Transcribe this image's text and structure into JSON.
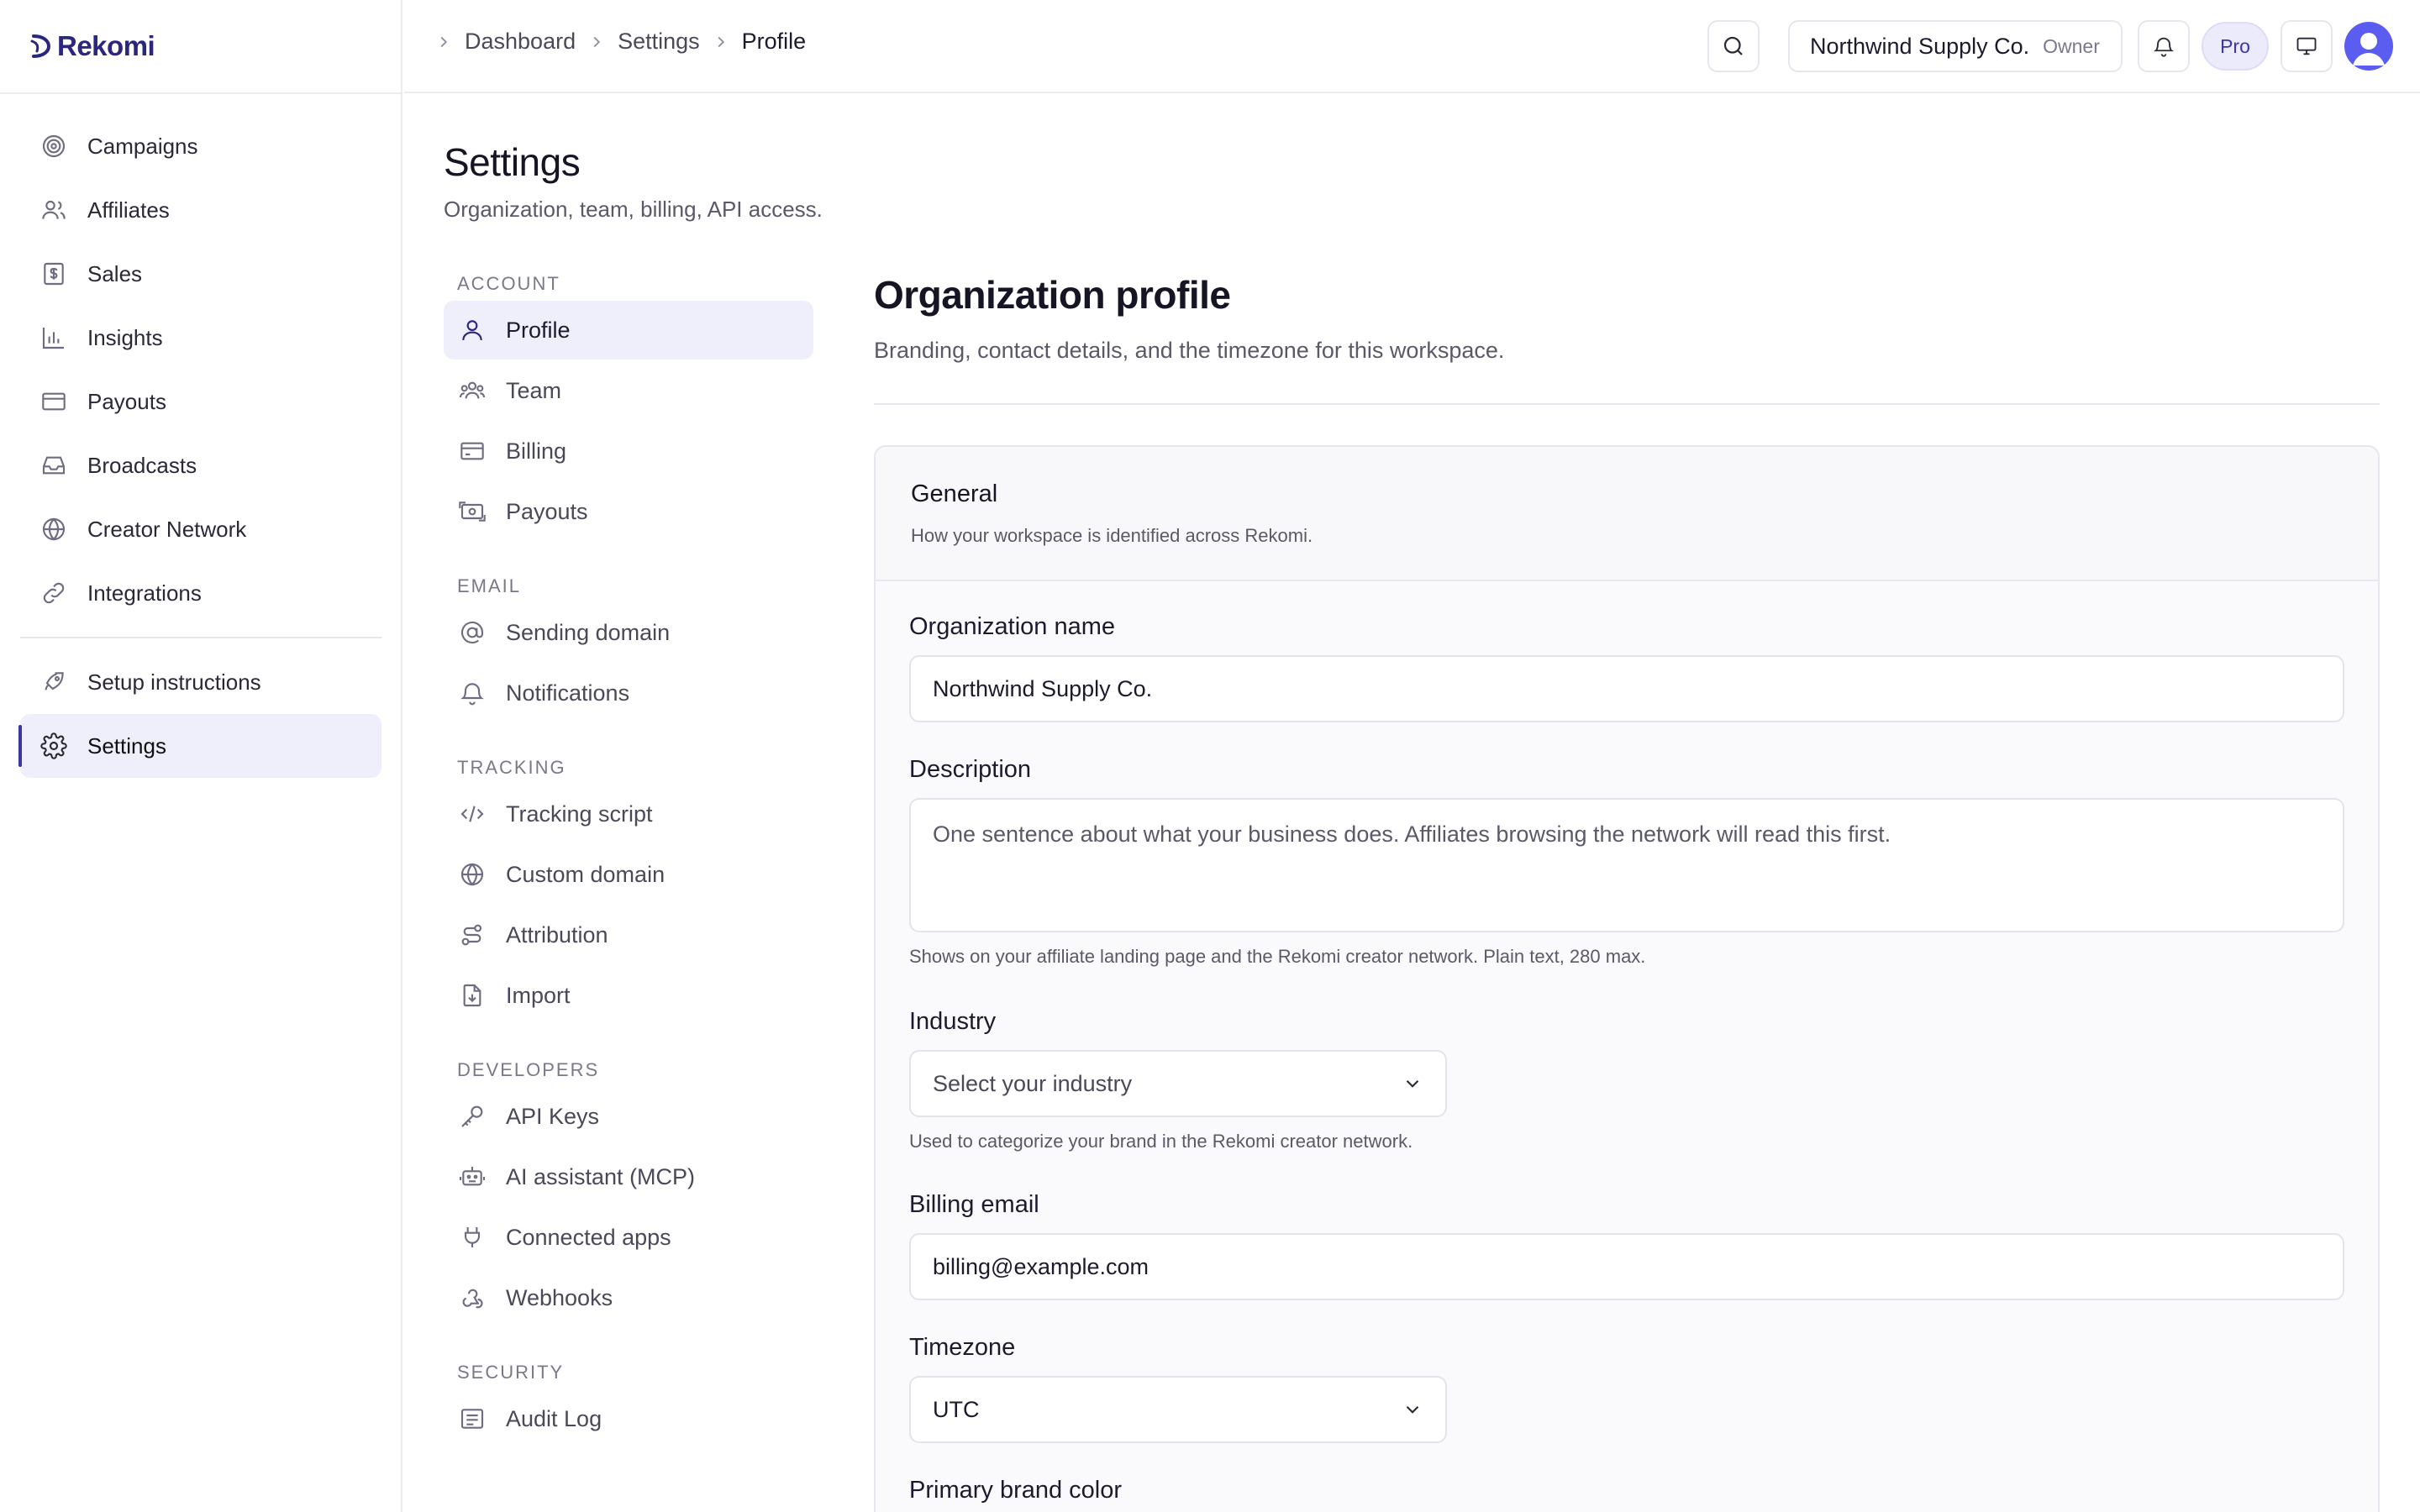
{
  "brand": {
    "name": "Rekomi",
    "accent": "#2b2680"
  },
  "sidebar": {
    "items": [
      {
        "label": "Campaigns",
        "icon": "target-icon"
      },
      {
        "label": "Affiliates",
        "icon": "users-icon"
      },
      {
        "label": "Sales",
        "icon": "receipt-icon"
      },
      {
        "label": "Insights",
        "icon": "bar-chart-icon"
      },
      {
        "label": "Payouts",
        "icon": "credit-card-icon"
      },
      {
        "label": "Broadcasts",
        "icon": "inbox-icon"
      },
      {
        "label": "Creator Network",
        "icon": "globe-icon"
      },
      {
        "label": "Integrations",
        "icon": "link-icon"
      }
    ],
    "bottom_items": [
      {
        "label": "Setup instructions",
        "icon": "rocket-icon"
      },
      {
        "label": "Settings",
        "icon": "gear-icon",
        "active": true
      }
    ]
  },
  "topbar": {
    "breadcrumb": [
      "Dashboard",
      "Settings",
      "Profile"
    ],
    "org_name": "Northwind Supply Co.",
    "org_role": "Owner",
    "plan_badge": "Pro"
  },
  "page": {
    "title": "Settings",
    "subtitle": "Organization, team, billing, API access."
  },
  "subnav": {
    "account_heading": "ACCOUNT",
    "account": [
      {
        "label": "Profile",
        "icon": "user-icon",
        "active": true
      },
      {
        "label": "Team",
        "icon": "team-icon"
      },
      {
        "label": "Billing",
        "icon": "card-icon"
      },
      {
        "label": "Payouts",
        "icon": "money-icon"
      }
    ],
    "email_heading": "EMAIL",
    "email": [
      {
        "label": "Sending domain",
        "icon": "at-icon"
      },
      {
        "label": "Notifications",
        "icon": "bell-icon"
      }
    ],
    "tracking_heading": "TRACKING",
    "tracking": [
      {
        "label": "Tracking script",
        "icon": "code-icon"
      },
      {
        "label": "Custom domain",
        "icon": "globe-icon"
      },
      {
        "label": "Attribution",
        "icon": "route-icon"
      },
      {
        "label": "Import",
        "icon": "file-import-icon"
      }
    ],
    "developers_heading": "DEVELOPERS",
    "developers": [
      {
        "label": "API Keys",
        "icon": "key-icon"
      },
      {
        "label": "AI assistant (MCP)",
        "icon": "robot-icon"
      },
      {
        "label": "Connected apps",
        "icon": "plug-icon"
      },
      {
        "label": "Webhooks",
        "icon": "webhook-icon"
      }
    ],
    "security_heading": "SECURITY",
    "security": [
      {
        "label": "Audit Log",
        "icon": "log-icon"
      }
    ]
  },
  "main": {
    "title": "Organization profile",
    "subtitle": "Branding, contact details, and the timezone for this workspace.",
    "card_title": "General",
    "card_subtitle": "How your workspace is identified across Rekomi.",
    "org_name_label": "Organization name",
    "org_name_value": "Northwind Supply Co.",
    "description_label": "Description",
    "description_placeholder": "One sentence about what your business does. Affiliates browsing the network will read this first.",
    "description_help": "Shows on your affiliate landing page and the Rekomi creator network. Plain text, 280 max.",
    "industry_label": "Industry",
    "industry_value": "Select your industry",
    "industry_help": "Used to categorize your brand in the Rekomi creator network.",
    "billing_email_label": "Billing email",
    "billing_email_value": "billing@example.com",
    "timezone_label": "Timezone",
    "timezone_value": "UTC",
    "brand_color_label": "Primary brand color"
  }
}
